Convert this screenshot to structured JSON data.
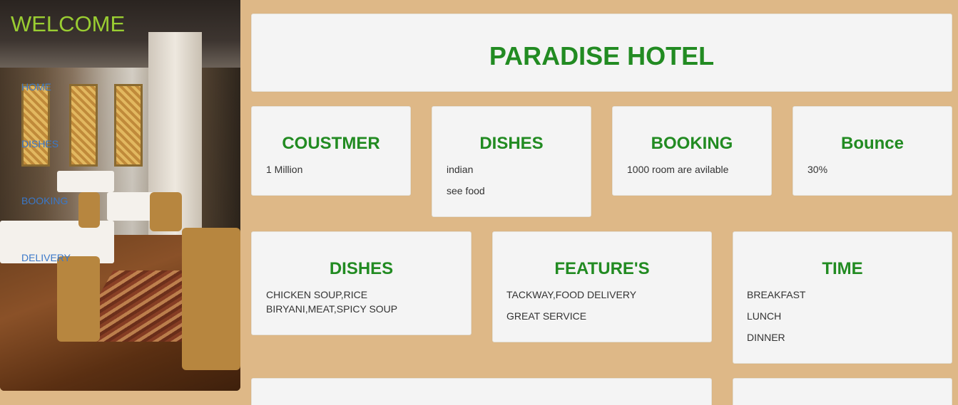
{
  "sidebar": {
    "welcome": "WELCOME",
    "nav": [
      "HOME",
      "DISHES",
      "BOOKING",
      "DELIVERY"
    ]
  },
  "header": {
    "title": "PARADISE HOTEL"
  },
  "row1": [
    {
      "title": "COUSTMER",
      "lines": [
        "1 Million"
      ]
    },
    {
      "title": "DISHES",
      "lines": [
        "indian",
        "see food"
      ]
    },
    {
      "title": "BOOKING",
      "lines": [
        "1000 room are avilable"
      ]
    },
    {
      "title": "Bounce",
      "lines": [
        "30%"
      ]
    }
  ],
  "row2": [
    {
      "title": "DISHES",
      "lines": [
        "CHICKEN SOUP,RICE",
        "BIRYANI,MEAT,SPICY SOUP"
      ]
    },
    {
      "title": "FEATURE'S",
      "lines": [
        "TACKWAY,FOOD DELIVERY",
        "GREAT SERVICE"
      ]
    },
    {
      "title": "TIME",
      "lines": [
        "BREAKFAST",
        "LUNCH",
        "DINNER"
      ]
    }
  ],
  "colors": {
    "background": "#DEB887",
    "heading": "#228B22",
    "welcome": "#9ACD32",
    "link": "#3a78c9",
    "card": "#f4f4f4"
  }
}
